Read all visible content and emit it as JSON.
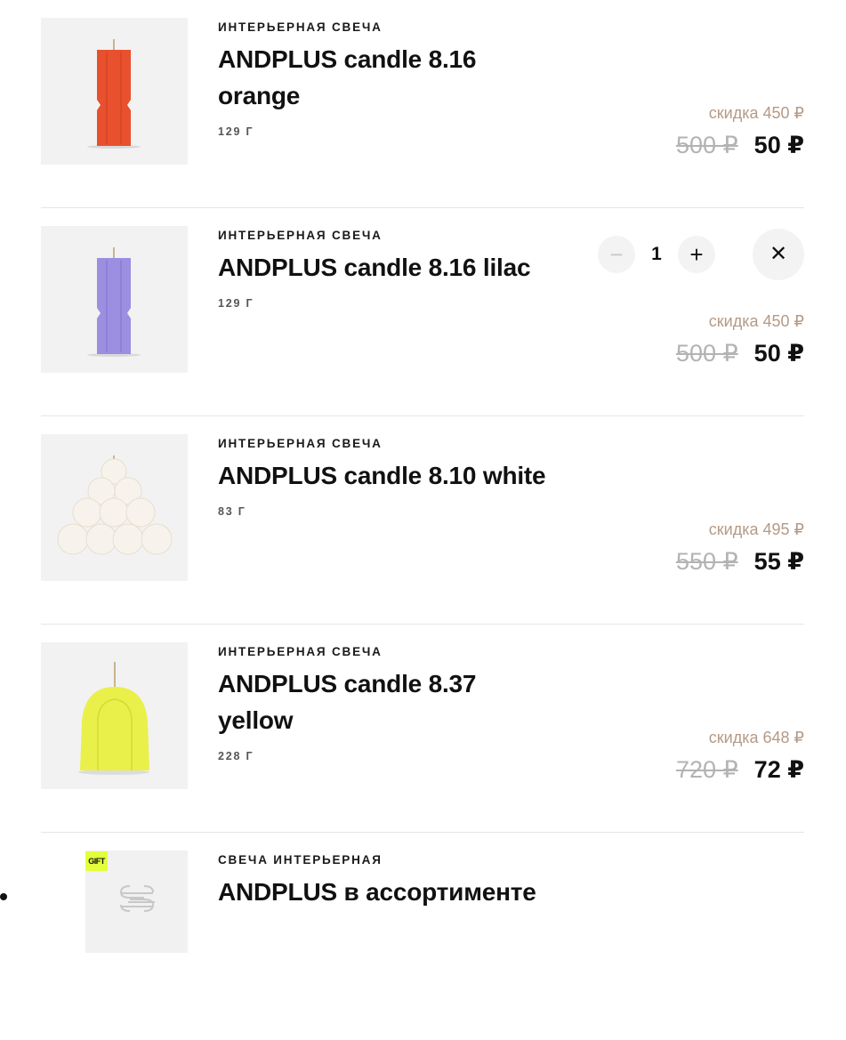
{
  "colors": {
    "discount": "#b49a86",
    "old_price": "#b3b3b3",
    "gift_badge": "#e3ff3b",
    "candle_orange": "#e8502e",
    "candle_lilac": "#9c8ee0",
    "candle_white": "#f7f3ec",
    "candle_yellow": "#eaf04a"
  },
  "cart": {
    "items": [
      {
        "category": "ИНТЕРЬЕРНАЯ СВЕЧА",
        "title": "ANDPLUS candle 8.16 orange",
        "weight": "129 Г",
        "discount": "скидка 450 ₽",
        "old_price": "500 ₽",
        "new_price": "50 ₽",
        "image": "orange-pillar-candle"
      },
      {
        "category": "ИНТЕРЬЕРНАЯ СВЕЧА",
        "title": "ANDPLUS candle 8.16 lilac",
        "weight": "129 Г",
        "discount": "скидка 450 ₽",
        "old_price": "500 ₽",
        "new_price": "50 ₽",
        "image": "lilac-pillar-candle",
        "quantity": "1",
        "minus_icon": "minus-icon",
        "plus_icon": "plus-icon",
        "remove_icon": "close-icon"
      },
      {
        "category": "ИНТЕРЬЕРНАЯ СВЕЧА",
        "title": "ANDPLUS candle 8.10 white",
        "weight": "83 Г",
        "discount": "скидка 495 ₽",
        "old_price": "550 ₽",
        "new_price": "55 ₽",
        "image": "white-sphere-pyramid-candle"
      },
      {
        "category": "ИНТЕРЬЕРНАЯ СВЕЧА",
        "title": "ANDPLUS candle 8.37 yellow",
        "weight": "228 Г",
        "discount": "скидка 648 ₽",
        "old_price": "720 ₽",
        "new_price": "72 ₽",
        "image": "yellow-arch-candle"
      }
    ],
    "gift": {
      "badge": "GIFT",
      "category": "СВЕЧА ИНТЕРЬЕРНАЯ",
      "title": "ANDPLUS в ассортименте",
      "image": "andplus-logo-icon"
    }
  }
}
